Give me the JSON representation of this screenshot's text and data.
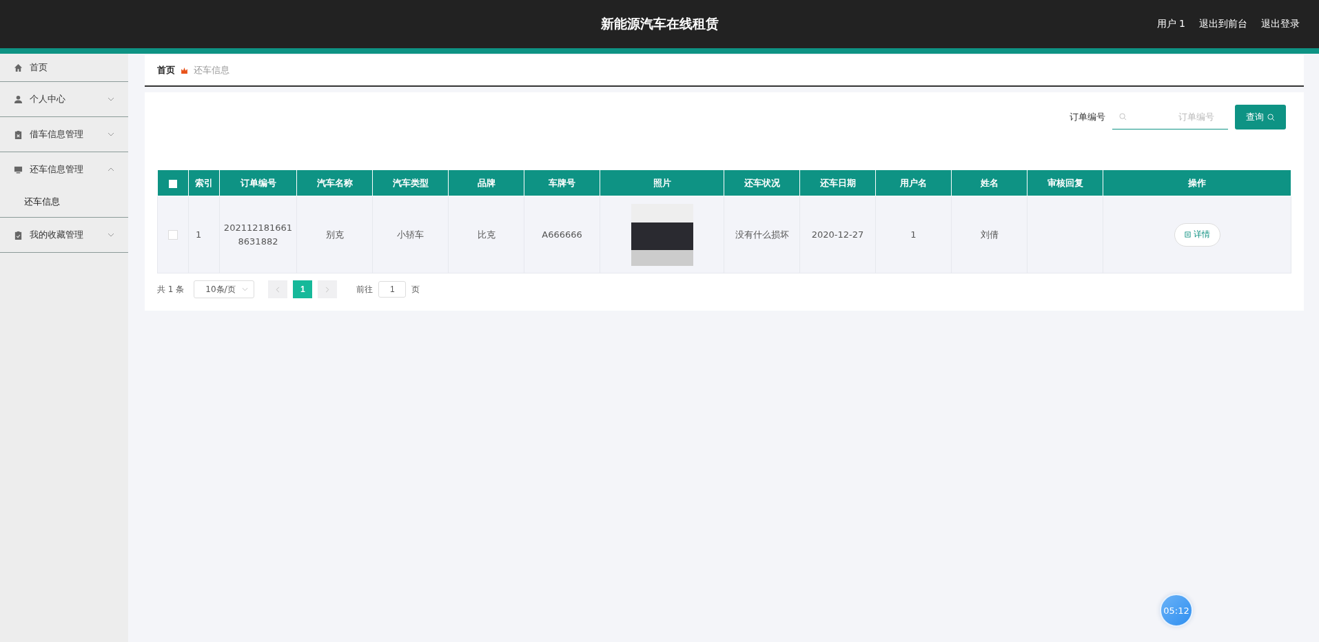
{
  "header": {
    "title": "新能源汽车在线租赁",
    "links": [
      "用户 1",
      "退出到前台",
      "退出登录"
    ]
  },
  "sidebar": {
    "items": [
      {
        "label": "首页",
        "kind": "home"
      },
      {
        "label": "个人中心",
        "kind": "user",
        "expanded": false
      },
      {
        "label": "借车信息管理",
        "kind": "clipboard-x",
        "expanded": false
      },
      {
        "label": "还车信息管理",
        "kind": "monitor",
        "expanded": true,
        "children": [
          {
            "label": "还车信息"
          }
        ]
      },
      {
        "label": "我的收藏管理",
        "kind": "clipboard-check",
        "expanded": false
      }
    ]
  },
  "breadcrumb": [
    "首页",
    "还车信息"
  ],
  "search": {
    "label": "订单编号",
    "placeholder": "订单编号",
    "button": "查询"
  },
  "table": {
    "select_all_checked": false,
    "columns": [
      "索引",
      "订单编号",
      "汽车名称",
      "汽车类型",
      "品牌",
      "车牌号",
      "照片",
      "还车状况",
      "还车日期",
      "用户名",
      "姓名",
      "审核回复",
      "操作"
    ],
    "rows": [
      {
        "checked": false,
        "cells": [
          "1",
          "2021121816618631882",
          "别克",
          "小轿车",
          "比克",
          "A666666",
          null,
          "没有什么损坏",
          "2020-12-27",
          "1",
          "刘倩",
          ""
        ],
        "action": "详情"
      }
    ]
  },
  "pagination": {
    "total": "共 1 条",
    "page_size": "10条/页",
    "pages": [
      {
        "label": "1",
        "selected": true
      }
    ],
    "goto": "前往",
    "page_input": "1",
    "page_suffix": "页"
  },
  "clock": "05:12"
}
